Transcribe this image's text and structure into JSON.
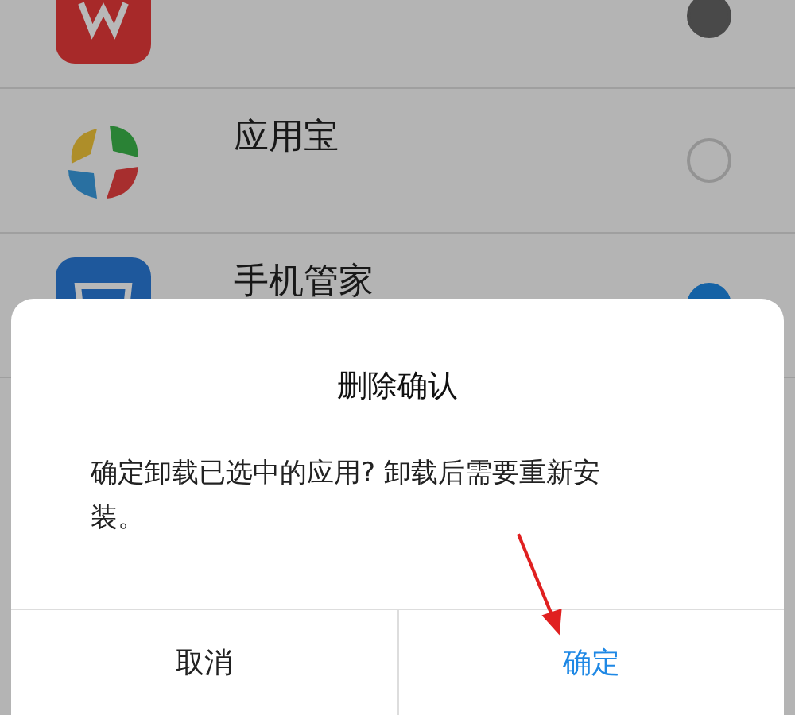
{
  "apps": [
    {
      "checked": true
    },
    {
      "name": "应用宝",
      "checked": false
    },
    {
      "name": "手机管家",
      "checked": true
    }
  ],
  "dialog": {
    "title": "删除确认",
    "message": "确定卸载已选中的应用? 卸载后需要重新安装。",
    "buttons": [
      "取消",
      "确定"
    ]
  }
}
